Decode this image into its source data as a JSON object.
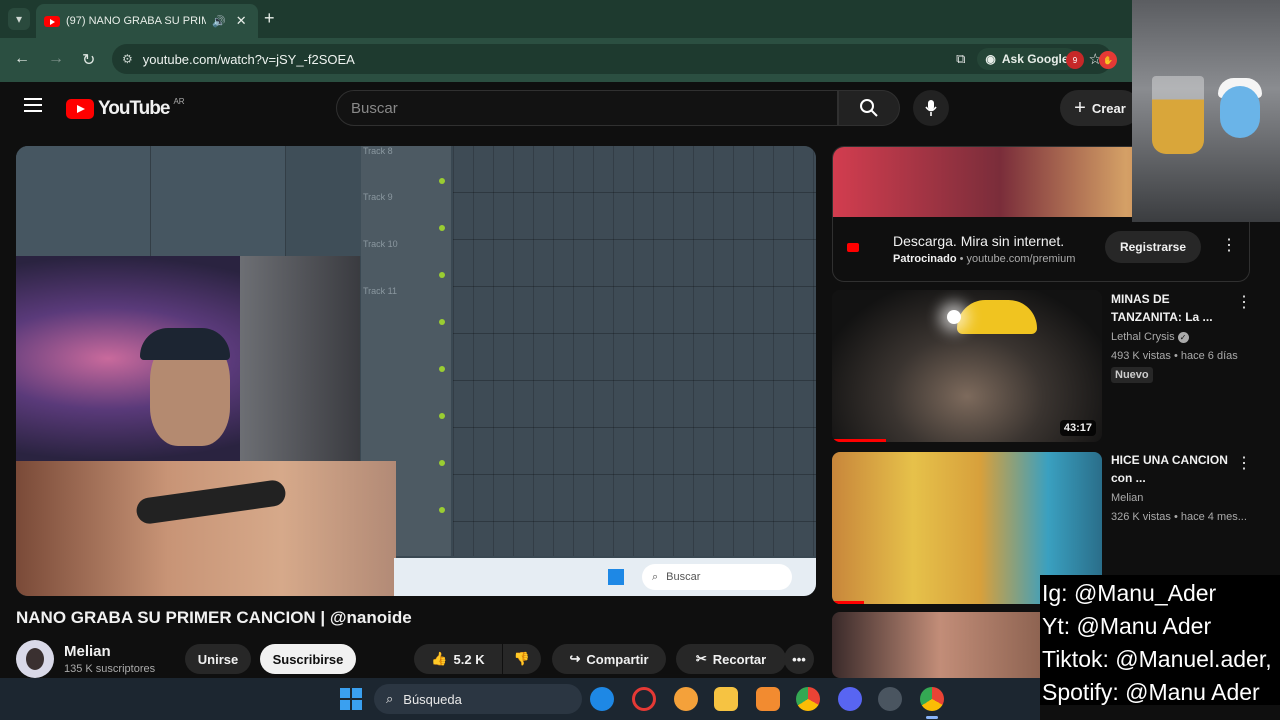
{
  "browser": {
    "tab_title": "(97) NANO GRABA SU PRIM",
    "speaker_icon": "speaker-icon",
    "close_icon": "close-icon",
    "new_tab_icon": "plus-icon",
    "url": "youtube.com/watch?v=jSY_-f2SOEA",
    "ask_google": "Ask Google",
    "extension_badge": "9"
  },
  "youtube": {
    "logo_text": "YouTube",
    "region": "AR",
    "search_placeholder": "Buscar",
    "create_label": "Crear"
  },
  "player": {
    "track_labels": [
      "Track 8",
      "Track 9",
      "Track 10",
      "Track 11"
    ],
    "taskbar_search": "Buscar"
  },
  "video": {
    "title": "NANO GRABA SU PRIMER CANCION | @nanoide",
    "channel": "Melian",
    "subscribers": "135 K suscriptores",
    "join_label": "Unirse",
    "subscribe_label": "Suscribirse",
    "likes": "5.2 K",
    "share_label": "Compartir",
    "clip_label": "Recortar"
  },
  "ad": {
    "title": "Descarga. Mira sin internet.",
    "sponsored": "Patrocinado",
    "domain": "youtube.com/premium",
    "cta": "Registrarse"
  },
  "recommendations": [
    {
      "title": "MINAS DE TANZANITA: La ...",
      "channel": "Lethal Crysis",
      "meta": "493 K vistas • hace 6 días",
      "badge": "Nuevo",
      "duration": "43:17",
      "watched_fraction": 0.2
    },
    {
      "title": "HICE UNA CANCION con ...",
      "channel": "Melian",
      "meta": "326 K vistas • hace 4 mes..."
    }
  ],
  "overlay_text": [
    "Ig: @Manu_Ader",
    "Yt: @Manu Ader",
    "Tiktok: @Manuel.ader,",
    "Spotify: @Manu Ader"
  ],
  "taskbar": {
    "search_label": "Búsqueda"
  },
  "colors": {
    "accent_red": "#ff0000",
    "browser_frame": "#2b4f41",
    "yt_background": "#0f0f0f"
  }
}
